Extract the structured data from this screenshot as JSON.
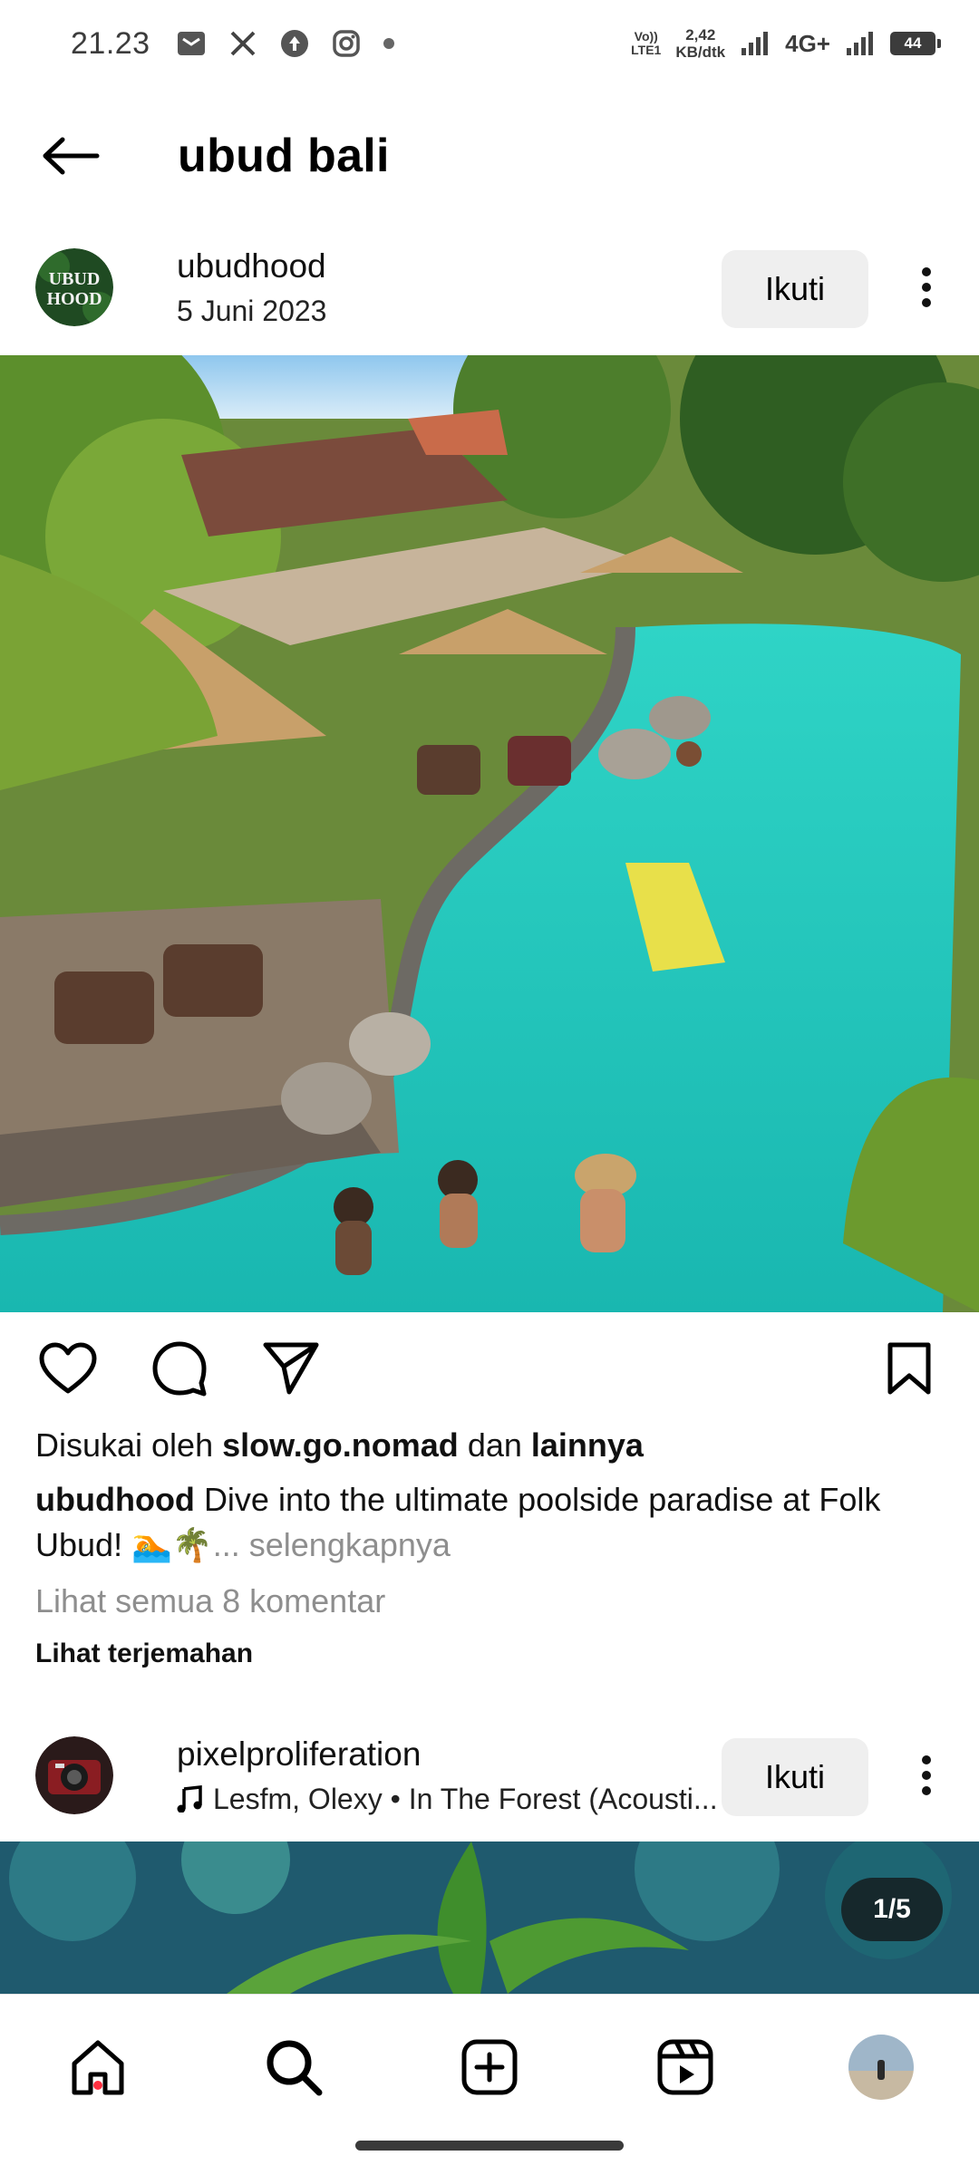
{
  "status_bar": {
    "time": "21.23",
    "volte_top": "Vo))",
    "volte_bottom": "LTE1",
    "speed_value": "2,42",
    "speed_unit": "KB/dtk",
    "network_type": "4G+",
    "battery": "44"
  },
  "header": {
    "title": "ubud bali",
    "back_icon": "arrow-left-icon"
  },
  "post1": {
    "username": "ubudhood",
    "avatar_text_line1": "UBUD",
    "avatar_text_line2": "HOOD",
    "date": "5 Juni 2023",
    "follow_label": "Ikuti",
    "likes_prefix": "Disukai oleh",
    "liked_by": "slow.go.nomad",
    "likes_connector": "dan",
    "likes_others": "lainnya",
    "caption_user": "ubudhood",
    "caption_text": "Dive into the ultimate poolside paradise at Folk Ubud!",
    "caption_emoji": "🏊🌴",
    "caption_more": "... selengkapnya",
    "view_comments": "Lihat semua 8 komentar",
    "translate": "Lihat terjemahan"
  },
  "post2": {
    "username": "pixelproliferation",
    "music": "Lesfm, Olexy • In The Forest (Acousti...",
    "follow_label": "Ikuti",
    "image_counter": "1/5"
  },
  "bottom_nav": {
    "items": [
      "home-icon",
      "search-icon",
      "create-icon",
      "reels-icon",
      "profile-avatar"
    ],
    "home_notification_color": "#ff3040"
  },
  "colors": {
    "pool": "#1fc9bb",
    "follow_bg": "#efefef",
    "secondary_text": "#8e8e8e"
  }
}
